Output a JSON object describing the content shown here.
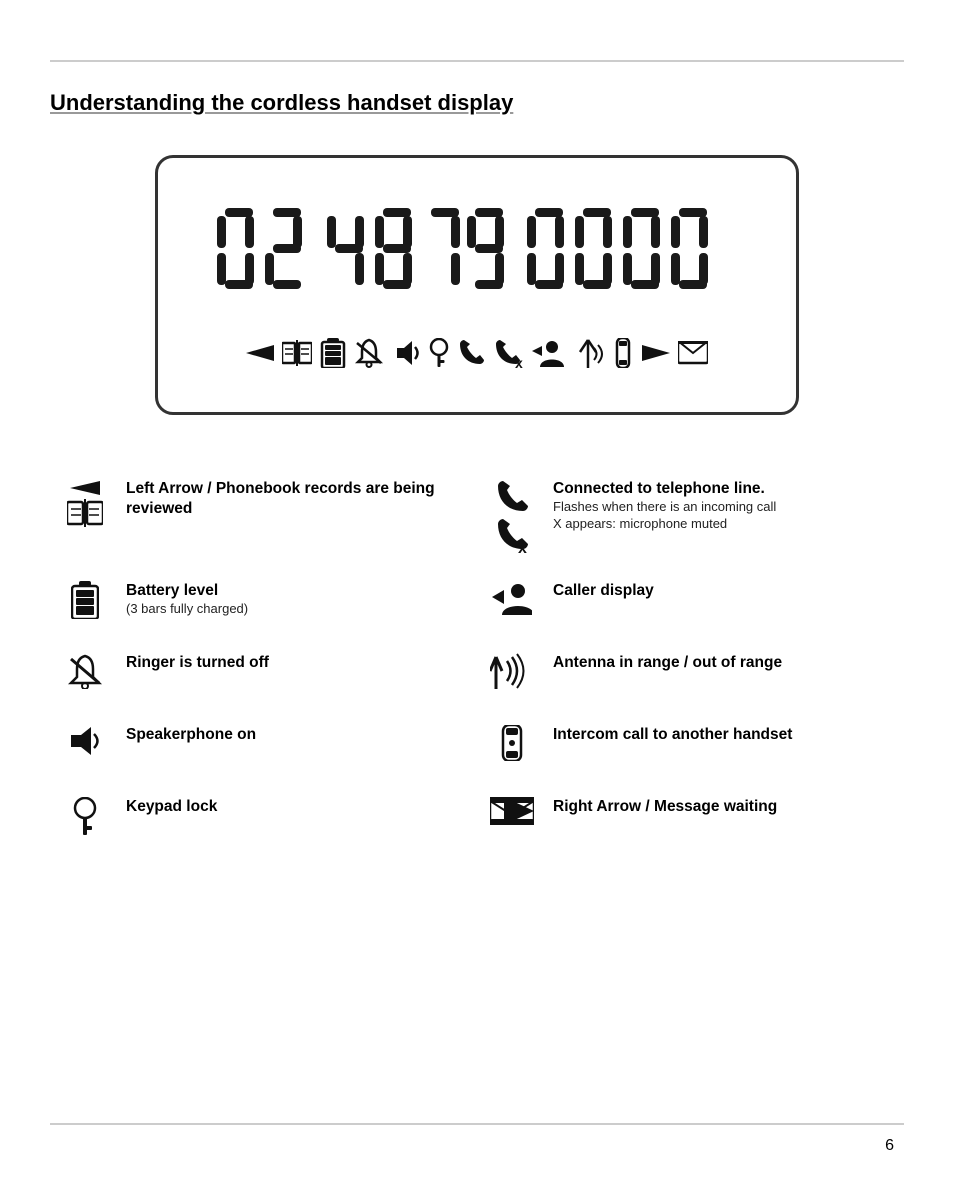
{
  "page": {
    "title": "Understanding the cordless handset display",
    "page_number": "6"
  },
  "display": {
    "digits": "02 4879 0000",
    "icons_description": "phonebook battery ringer speaker key phone caller antenna intercom mail"
  },
  "legend": {
    "left_items": [
      {
        "id": "phonebook",
        "title": "Left Arrow / Phonebook records are being reviewed",
        "subtitle": "",
        "icon_type": "phonebook"
      },
      {
        "id": "battery",
        "title": "Battery level",
        "subtitle": "(3 bars fully charged)",
        "icon_type": "battery"
      },
      {
        "id": "ringer",
        "title": "Ringer is turned off",
        "subtitle": "",
        "icon_type": "ringer"
      },
      {
        "id": "speaker",
        "title": "Speakerphone on",
        "subtitle": "",
        "icon_type": "speaker"
      },
      {
        "id": "keypad",
        "title": "Keypad lock",
        "subtitle": "",
        "icon_type": "key"
      }
    ],
    "right_items": [
      {
        "id": "telephone",
        "title": "Connected to telephone line.",
        "subtitle": "Flashes when there is an incoming call\nX appears: microphone muted",
        "icon_type": "phone"
      },
      {
        "id": "caller",
        "title": "Caller display",
        "subtitle": "",
        "icon_type": "caller"
      },
      {
        "id": "antenna",
        "title": "Antenna in range / out of range",
        "subtitle": "",
        "icon_type": "antenna"
      },
      {
        "id": "intercom",
        "title": "Intercom call to another handset",
        "subtitle": "",
        "icon_type": "intercom"
      },
      {
        "id": "message",
        "title": "Right Arrow / Message waiting",
        "subtitle": "",
        "icon_type": "mail"
      }
    ]
  }
}
